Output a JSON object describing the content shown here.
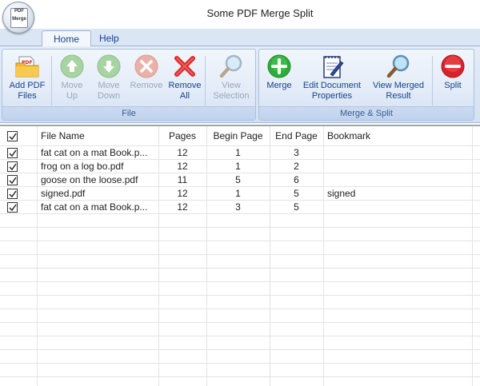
{
  "window": {
    "title": "Some PDF Merge Split",
    "logo_text": [
      "PDF",
      "Merge"
    ]
  },
  "tabs": [
    {
      "label": "Home",
      "active": true
    },
    {
      "label": "Help",
      "active": false
    }
  ],
  "ribbon": {
    "file_group": {
      "label": "File",
      "buttons": {
        "add_pdf_files": {
          "line1": "Add PDF",
          "line2": "Files",
          "enabled": true,
          "icon": "folder-icon"
        },
        "move_up": {
          "line1": "Move",
          "line2": "Up",
          "enabled": false,
          "icon": "arrow-up-icon"
        },
        "move_down": {
          "line1": "Move",
          "line2": "Down",
          "enabled": false,
          "icon": "arrow-down-icon"
        },
        "remove": {
          "line1": "Remove",
          "line2": "",
          "enabled": false,
          "icon": "remove-icon"
        },
        "remove_all": {
          "line1": "Remove",
          "line2": "All",
          "enabled": true,
          "icon": "red-x-icon"
        },
        "view_selection": {
          "line1": "View",
          "line2": "Selection",
          "enabled": false,
          "icon": "magnifier-icon"
        }
      }
    },
    "merge_split_group": {
      "label": "Merge & Split",
      "buttons": {
        "merge": {
          "line1": "Merge",
          "line2": "",
          "enabled": true,
          "icon": "green-plus-icon"
        },
        "edit_document_properties": {
          "line1": "Edit Document",
          "line2": "Properties",
          "enabled": true,
          "icon": "notepad-icon"
        },
        "view_merged_result": {
          "line1": "View Merged",
          "line2": "Result",
          "enabled": true,
          "icon": "magnifier-icon"
        },
        "split": {
          "line1": "Split",
          "line2": "",
          "enabled": true,
          "icon": "red-minus-icon"
        }
      }
    }
  },
  "table": {
    "columns": [
      "File Name",
      "Pages",
      "Begin Page",
      "End Page",
      "Bookmark"
    ],
    "header_checked": true,
    "rows": [
      {
        "checked": true,
        "file_name": "fat cat on a mat Book.p...",
        "pages": "12",
        "begin_page": "1",
        "end_page": "3",
        "bookmark": ""
      },
      {
        "checked": true,
        "file_name": "frog on a log bo.pdf",
        "pages": "12",
        "begin_page": "1",
        "end_page": "2",
        "bookmark": ""
      },
      {
        "checked": true,
        "file_name": "goose on the loose.pdf",
        "pages": "11",
        "begin_page": "5",
        "end_page": "6",
        "bookmark": ""
      },
      {
        "checked": true,
        "file_name": "signed.pdf",
        "pages": "12",
        "begin_page": "1",
        "end_page": "5",
        "bookmark": "signed"
      },
      {
        "checked": true,
        "file_name": "fat cat on a mat Book.p...",
        "pages": "12",
        "begin_page": "3",
        "end_page": "5",
        "bookmark": ""
      }
    ]
  },
  "colors": {
    "ribbon_text": "#15428b",
    "disabled_text": "#9aa8bb",
    "tab_bar": "#dbe6f4"
  }
}
